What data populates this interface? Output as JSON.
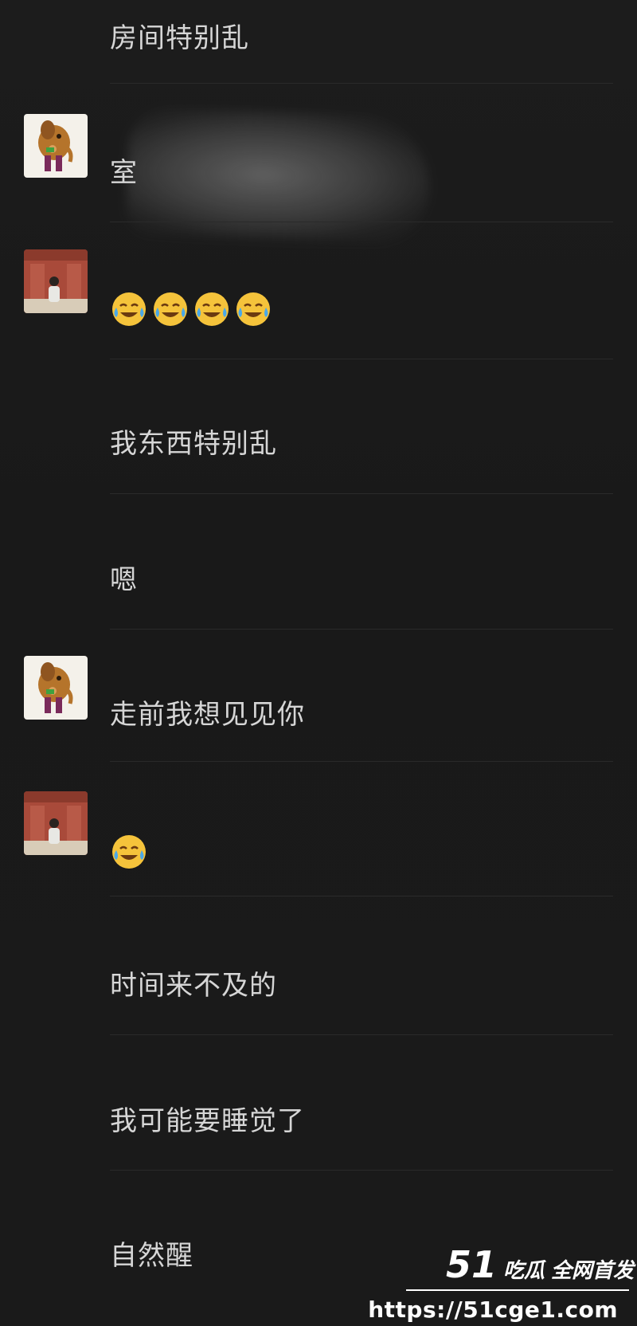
{
  "messages": [
    {
      "text": "房间特别乱"
    },
    {
      "text": "室"
    },
    {
      "emoji": [
        "tears-of-joy-emoji",
        "tears-of-joy-emoji",
        "tears-of-joy-emoji",
        "tears-of-joy-emoji"
      ]
    },
    {
      "text": "我东西特别乱"
    },
    {
      "text": "嗯"
    },
    {
      "text": "走前我想见见你"
    },
    {
      "emoji": [
        "tears-of-joy-emoji"
      ]
    },
    {
      "text": "时间来不及的"
    },
    {
      "text": "我可能要睡觉了"
    },
    {
      "text": "自然醒"
    }
  ],
  "watermark": {
    "number": "51",
    "brand": "吃瓜",
    "tagline": "全网首发",
    "url": "https://51cge1.com"
  },
  "colors": {
    "background": "#1b1b1b",
    "text": "#d6d6d6",
    "divider": "#2a2a2a",
    "emoji": "#f5c33b"
  }
}
